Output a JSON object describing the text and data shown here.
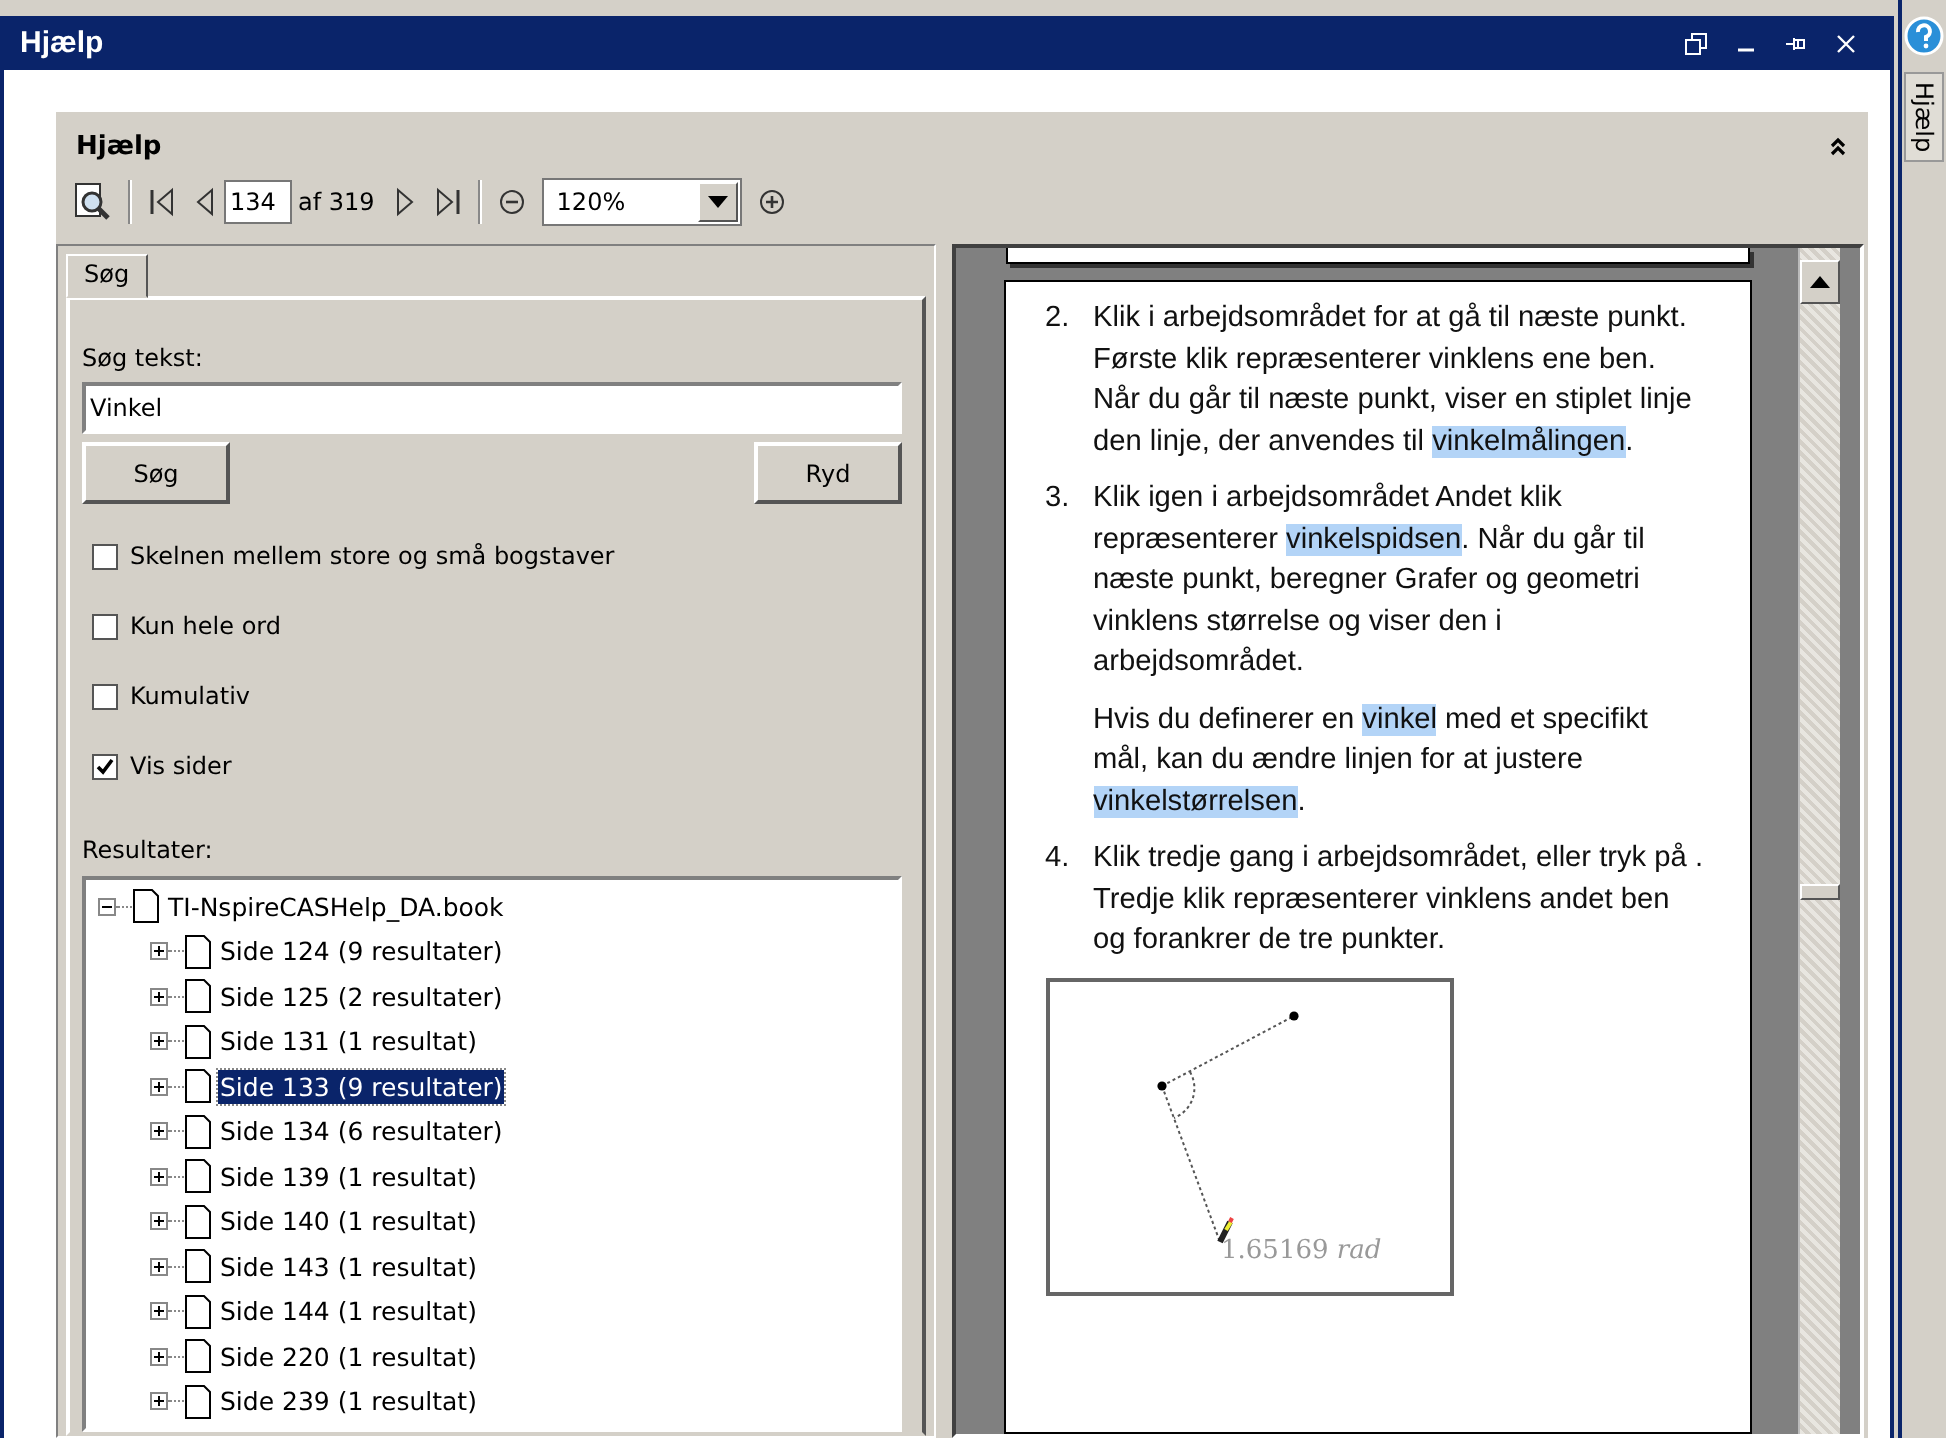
{
  "window": {
    "title": "Hjælp"
  },
  "side_tab": {
    "label": "Hjælp"
  },
  "panel": {
    "title": "Hjælp"
  },
  "toolbar": {
    "page": "134",
    "page_count": "af 319",
    "zoom": "120%"
  },
  "tabs": [
    {
      "label": "Søg",
      "selected": true
    }
  ],
  "search": {
    "label": "Søg tekst:",
    "value": "Vinkel",
    "buttons": [
      "Søg",
      "Ryd"
    ]
  },
  "options": [
    {
      "label": "Skelnen mellem store og små bogstaver",
      "checked": false
    },
    {
      "label": "Kun hele ord",
      "checked": false
    },
    {
      "label": "Kumulativ",
      "checked": false
    },
    {
      "label": "Vis sider",
      "checked": true
    }
  ],
  "results": {
    "label": "Resultater:",
    "tree": [
      {
        "label": "TI-NspireCASHelp_DA.book",
        "expanded": true,
        "selected": false,
        "children": [
          {
            "label": "Side 124 (9 resultater)",
            "expanded": false,
            "selected": false
          },
          {
            "label": "Side 125 (2 resultater)",
            "expanded": false,
            "selected": false
          },
          {
            "label": "Side 131 (1 resultat)",
            "expanded": false,
            "selected": false
          },
          {
            "label": "Side 133 (9 resultater)",
            "expanded": false,
            "selected": true
          },
          {
            "label": "Side 134 (6 resultater)",
            "expanded": false,
            "selected": false
          },
          {
            "label": "Side 139 (1 resultat)",
            "expanded": false,
            "selected": false
          },
          {
            "label": "Side 140 (1 resultat)",
            "expanded": false,
            "selected": false
          },
          {
            "label": "Side 143 (1 resultat)",
            "expanded": false,
            "selected": false
          },
          {
            "label": "Side 144 (1 resultat)",
            "expanded": false,
            "selected": false
          },
          {
            "label": "Side 220 (1 resultat)",
            "expanded": false,
            "selected": false
          },
          {
            "label": "Side 239 (1 resultat)",
            "expanded": false,
            "selected": false
          }
        ]
      }
    ]
  },
  "document": {
    "paragraphs": [
      {
        "number": "2.",
        "segments": [
          {
            "text": "Klik i arbejdsområdet for at gå til næste punkt. Første klik repræsenterer vinklens ene ben. Når du går til næste punkt, viser en stiplet linje den linje, der anvendes til ",
            "highlight": false
          },
          {
            "text": "vinkelmålingen",
            "highlight": true
          },
          {
            "text": ".",
            "highlight": false
          }
        ]
      },
      {
        "number": "3.",
        "segments": [
          {
            "text": "Klik igen i arbejdsområdet Andet klik repræsenterer ",
            "highlight": false
          },
          {
            "text": "vinkelspidsen",
            "highlight": true
          },
          {
            "text": ". Når du går til næste punkt, beregner Grafer og geometri vinklens størrelse og viser den i arbejdsområdet.",
            "highlight": false
          }
        ]
      },
      {
        "segments": [
          {
            "text": "Hvis du definerer en ",
            "highlight": false
          },
          {
            "text": "vinkel",
            "highlight": true
          },
          {
            "text": " med et specifikt mål, kan du ændre linjen for at justere ",
            "highlight": false
          },
          {
            "text": "vinkelstørrelsen",
            "highlight": true
          },
          {
            "text": ".",
            "highlight": false
          }
        ]
      },
      {
        "number": "4.",
        "segments": [
          {
            "text": "Klik tredje gang i arbejdsområdet, eller tryk på  . Tredje klik repræsenterer vinklens andet ben og forankrer de tre punkter.",
            "highlight": false
          }
        ]
      }
    ],
    "figure_label": "1.65169 *rad*"
  }
}
